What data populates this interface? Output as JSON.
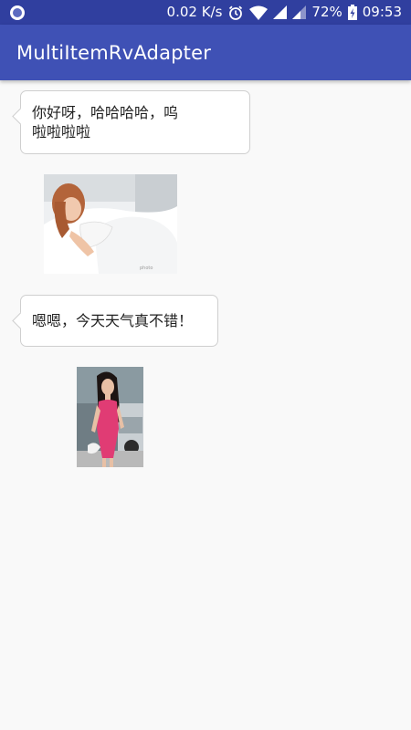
{
  "status_bar": {
    "speed": "0.02 K/s",
    "battery": "72%",
    "time": "09:53",
    "icons": [
      "screen-record-icon",
      "alarm-icon",
      "wifi-icon",
      "signal-icon",
      "signal-icon",
      "battery-charging-icon"
    ],
    "background": "#303f9f"
  },
  "app_bar": {
    "title": "MultiItemRvAdapter",
    "background": "#3f51b5"
  },
  "messages": [
    {
      "type": "text",
      "text": "你好呀，哈哈哈哈，呜\n啦啦啦啦"
    },
    {
      "type": "image",
      "icon": "photo-woman-on-bed"
    },
    {
      "type": "text",
      "text": "嗯嗯，今天天气真不错！"
    },
    {
      "type": "image",
      "icon": "photo-woman-pink-dress"
    }
  ],
  "colors": {
    "page_background": "#f9f9f9",
    "bubble_border": "#cfcfcf"
  }
}
